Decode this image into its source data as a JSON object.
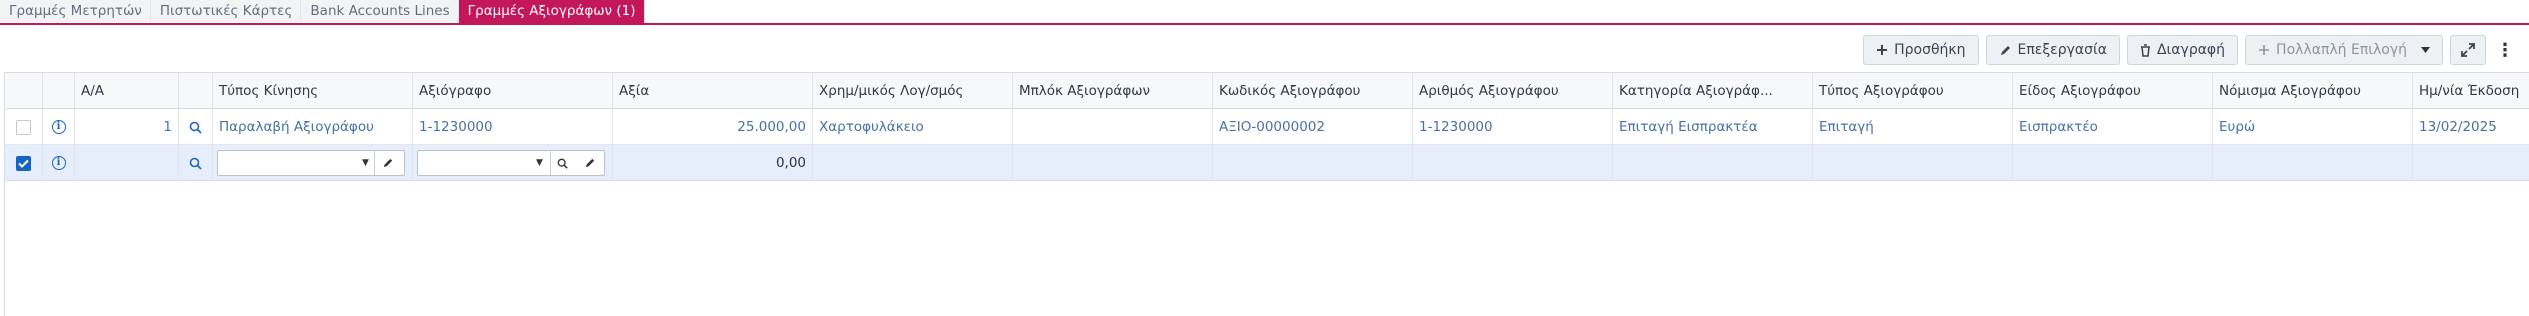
{
  "tabs": [
    {
      "label": "Γραμμές Μετρητών",
      "active": false
    },
    {
      "label": "Πιστωτικές Κάρτες",
      "active": false
    },
    {
      "label": "Bank Accounts Lines",
      "active": false
    },
    {
      "label": "Γραμμές Αξιογράφων (1)",
      "active": true
    }
  ],
  "toolbar": {
    "add_label": "Προσθήκη",
    "edit_label": "Επεξεργασία",
    "delete_label": "Διαγραφή",
    "multi_label": "Πολλαπλή Επιλογή"
  },
  "grid": {
    "columns": [
      "Α/Α",
      "Τύπος Κίνησης",
      "Αξιόγραφο",
      "Αξία",
      "Χρημ/μικός Λογ/σμός",
      "Μπλόκ Αξιογράφων",
      "Κωδικός Αξιογράφου",
      "Αριθμός Αξιογράφου",
      "Κατηγορία Αξιογράφ...",
      "Τύπος Αξιογράφου",
      "Είδος Αξιογράφου",
      "Νόμισμα Αξιογράφου",
      "Ημ/νία Έκδοση"
    ],
    "rows": [
      {
        "aa": "1",
        "movement_type": "Παραλαβή Αξιογράφου",
        "document": "1-1230000",
        "value": "25.000,00",
        "account": "Χαρτοφυλάκειο",
        "block": "",
        "code": "ΑΞΙΟ-00000002",
        "number": "1-1230000",
        "category": "Επιταγή Εισπρακτέα",
        "doc_type": "Επιταγή",
        "kind": "Εισπρακτέο",
        "currency": "Ευρώ",
        "issue_date": "13/02/2025"
      }
    ],
    "new_row": {
      "value": "0,00"
    }
  },
  "colors": {
    "accent": "#c2185b",
    "link": "#4a6fa5",
    "selected_row": "#e6eefb",
    "checkbox": "#1565c0"
  }
}
